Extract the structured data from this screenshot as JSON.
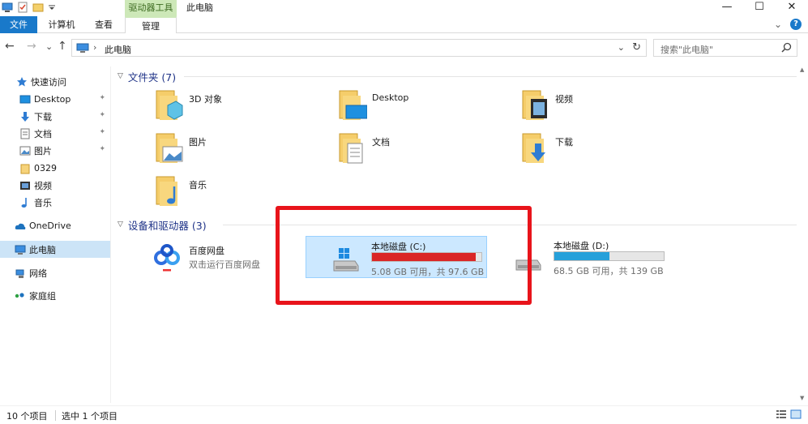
{
  "window": {
    "title": "此电脑",
    "context_tab_group": "驱动器工具",
    "buttons": {
      "minimize": "—",
      "maximize": "☐",
      "close": "✕"
    }
  },
  "ribbon": {
    "tabs": [
      "文件",
      "计算机",
      "查看",
      "管理"
    ],
    "active_tab": "文件",
    "expand_glyph": "⌄",
    "help_glyph": "?"
  },
  "address": {
    "back_glyph": "←",
    "forward_glyph": "→",
    "recent_glyph": "⌄",
    "up_glyph": "↑",
    "separator": "›",
    "path": "此电脑",
    "dropdown_glyph": "⌄",
    "refresh_glyph": "↻",
    "search_placeholder": "搜索\"此电脑\""
  },
  "nav": {
    "quick_access": "快速访问",
    "items": [
      {
        "label": "Desktop",
        "icon": "desktop-icon",
        "pinned": true
      },
      {
        "label": "下载",
        "icon": "download-icon",
        "pinned": true
      },
      {
        "label": "文档",
        "icon": "document-icon",
        "pinned": true
      },
      {
        "label": "图片",
        "icon": "picture-icon",
        "pinned": true
      },
      {
        "label": "0329",
        "icon": "folder-icon",
        "pinned": false
      },
      {
        "label": "视频",
        "icon": "video-icon",
        "pinned": false
      },
      {
        "label": "音乐",
        "icon": "music-icon",
        "pinned": false
      }
    ],
    "pin_glyph": "📌",
    "onedrive": "OneDrive",
    "this_pc": "此电脑",
    "network": "网络",
    "homegroup": "家庭组"
  },
  "groups": {
    "folders_header": "文件夹 (7)",
    "devices_header": "设备和驱动器 (3)"
  },
  "folders": [
    {
      "label": "3D 对象",
      "icon": "3d-objects-icon"
    },
    {
      "label": "Desktop",
      "icon": "desktop-folder-icon"
    },
    {
      "label": "视频",
      "icon": "video-folder-icon"
    },
    {
      "label": "图片",
      "icon": "picture-folder-icon"
    },
    {
      "label": "文档",
      "icon": "document-folder-icon"
    },
    {
      "label": "下载",
      "icon": "download-folder-icon"
    },
    {
      "label": "音乐",
      "icon": "music-folder-icon"
    }
  ],
  "baidu": {
    "label": "百度网盘",
    "sub": "双击运行百度网盘"
  },
  "drives": [
    {
      "label": "本地磁盘 (C:)",
      "free": "5.08 GB 可用，共 97.6 GB",
      "used_fraction": 0.948,
      "color": "#da2626",
      "selected": true
    },
    {
      "label": "本地磁盘 (D:)",
      "free": "68.5 GB 可用，共 139 GB",
      "used_fraction": 0.507,
      "color": "#26a0da",
      "selected": false
    }
  ],
  "status": {
    "count": "10 个项目",
    "selected": "选中 1 个项目"
  },
  "colors": {
    "accent": "#1979ca",
    "highlight": "#e8141b",
    "context_tab": "#cde8b8"
  }
}
